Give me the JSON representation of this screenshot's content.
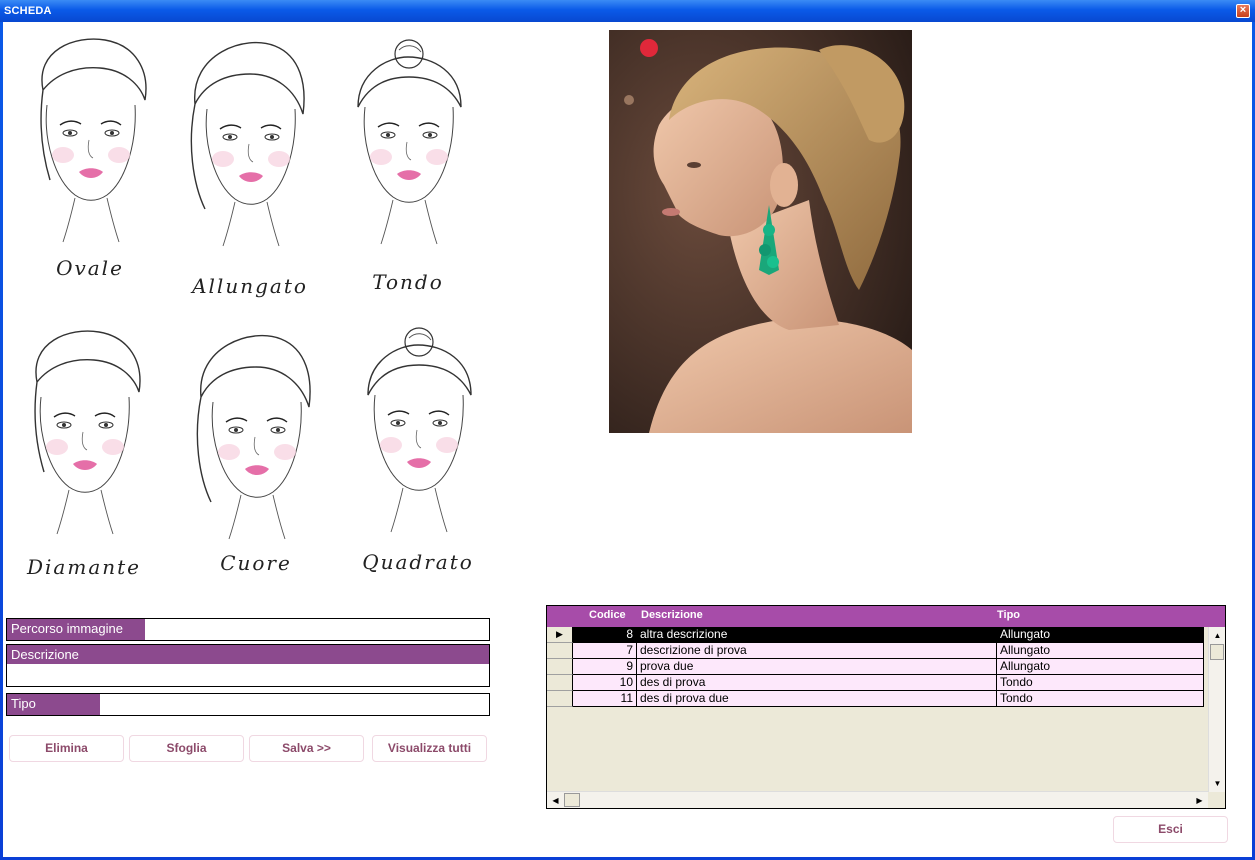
{
  "window": {
    "title": "SCHEDA",
    "close_glyph": "×"
  },
  "faces": [
    {
      "label": "Ovale"
    },
    {
      "label": "Allungato"
    },
    {
      "label": "Tondo"
    },
    {
      "label": "Diamante"
    },
    {
      "label": "Cuore"
    },
    {
      "label": "Quadrato"
    }
  ],
  "form": {
    "path_label": "Percorso immagine",
    "path_value": "",
    "description_label": "Descrizione",
    "description_value": "",
    "type_label": "Tipo",
    "type_value": ""
  },
  "buttons": {
    "delete": "Elimina",
    "browse": "Sfoglia",
    "save": "Salva >>",
    "show_all": "Visualizza tutti",
    "exit": "Esci"
  },
  "grid": {
    "columns": [
      "Codice",
      "Descrizione",
      "Tipo"
    ],
    "rows": [
      {
        "codice": "8",
        "descrizione": "altra descrizione",
        "tipo": "Allungato",
        "active": true
      },
      {
        "codice": "7",
        "descrizione": "descrizione di prova",
        "tipo": "Allungato",
        "active": false
      },
      {
        "codice": "9",
        "descrizione": "prova due",
        "tipo": "Allungato",
        "active": false
      },
      {
        "codice": "10",
        "descrizione": "des di prova",
        "tipo": "Tondo",
        "active": false
      },
      {
        "codice": "11",
        "descrizione": "des di prova due",
        "tipo": "Tondo",
        "active": false
      }
    ]
  },
  "colors": {
    "accent": "#8c4a8e",
    "header": "#a74ca9",
    "row_bg": "#fde8fb"
  }
}
